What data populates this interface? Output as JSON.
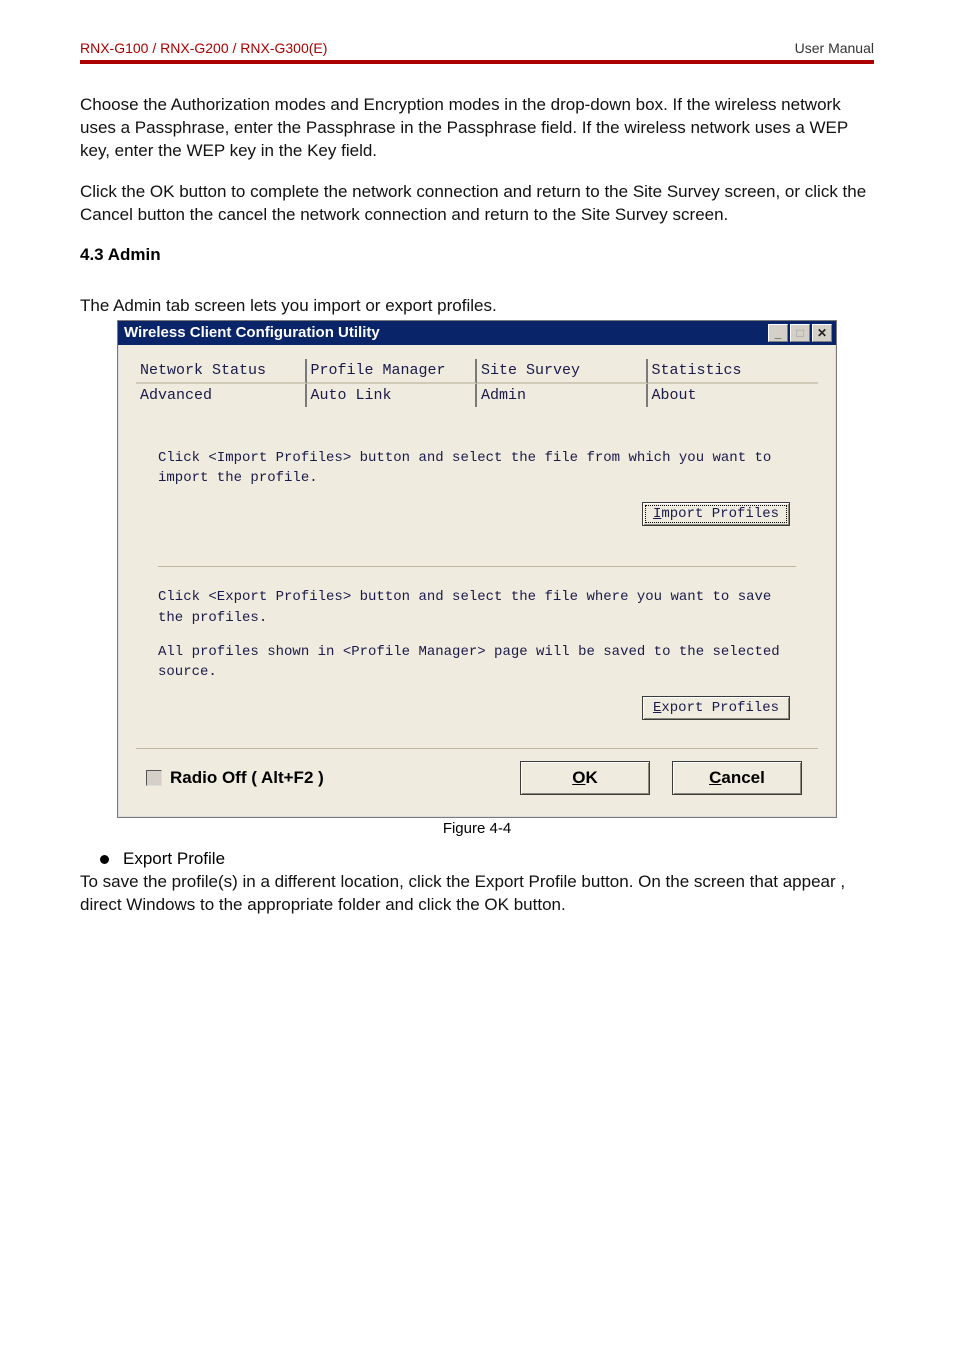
{
  "header": {
    "left": "RNX-G100  /  RNX-G200  /  RNX-G300(E)",
    "right": "User  Manual"
  },
  "paragraphs": {
    "intro1": "Choose the Authorization modes and Encryption modes in the drop-down box. If the wireless network uses a Passphrase, enter the Passphrase in the Passphrase field. If the wireless network uses a WEP key, enter the WEP key in the Key field.",
    "intro2": "Click the OK button to complete the network connection and return to the Site Survey screen, or click the Cancel button the cancel the network connection and return to the Site Survey screen.",
    "section_heading": "4.3 Admin",
    "lead": "The Admin tab screen lets you import or export profiles.",
    "figure_caption": "Figure 4-4",
    "bullet_label": "Export Profile",
    "after_bullet": "To save the profile(s) in a different location, click the Export Profile button. On the screen that appear , direct Windows to the appropriate folder and click the OK button."
  },
  "dialog": {
    "title": "Wireless Client Configuration Utility",
    "tabs_row1": [
      "Network Status",
      "Profile Manager",
      "Site Survey",
      "Statistics"
    ],
    "tabs_row2": [
      "Advanced",
      "Auto Link",
      "Admin",
      "About"
    ],
    "import_text": "Click <Import Profiles> button and select the file from which you want to import the profile.",
    "import_btn": "Import Profiles",
    "export_text1": "Click <Export Profiles> button and select the file where you want to save the profiles.",
    "export_text2": "All profiles shown in <Profile Manager> page will be saved to the selected source.",
    "export_btn": "Export Profiles",
    "radio_off": "Radio Off  ( Alt+F2 )",
    "ok_btn": "OK",
    "cancel_btn": "Cancel",
    "win_min": "_",
    "win_max": "□",
    "win_close": "✕"
  }
}
